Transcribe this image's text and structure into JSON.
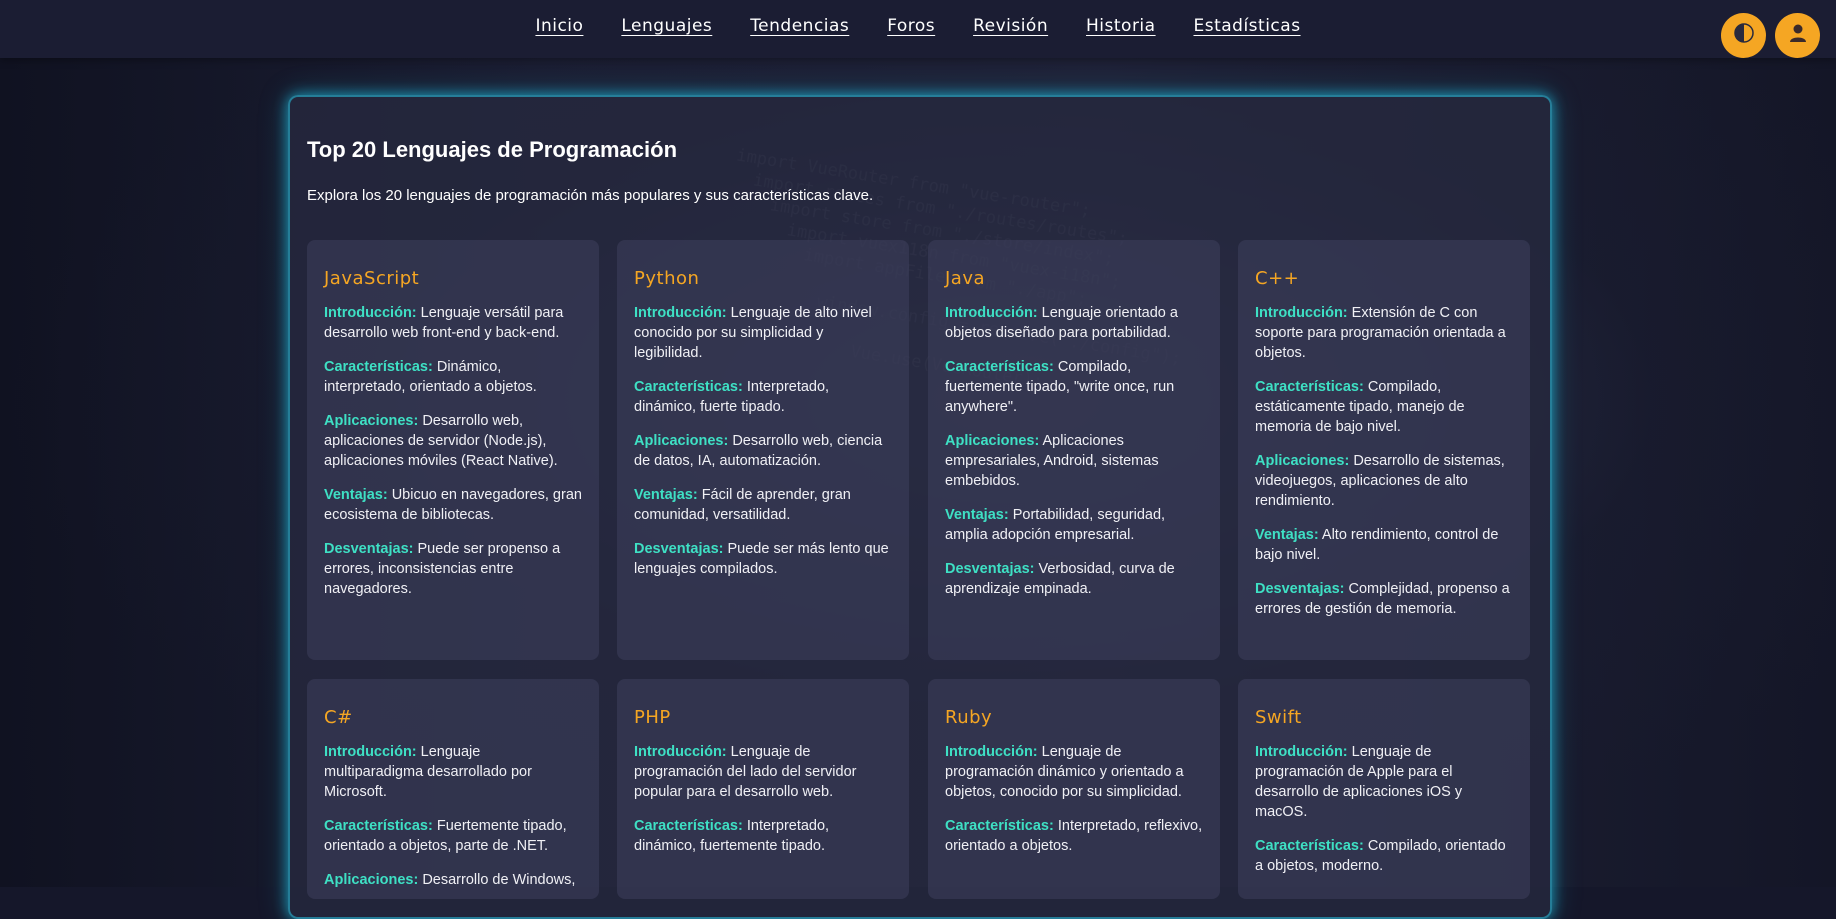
{
  "nav": {
    "links": [
      "Inicio",
      "Lenguajes",
      "Tendencias",
      "Foros",
      "Revisión",
      "Historia",
      "Estadísticas"
    ],
    "theme_toggle_icon": "theme-toggle-icon",
    "user_icon": "user-icon",
    "accent_color": "#f5a623"
  },
  "main": {
    "title": "Top 20 Lenguajes de Programación",
    "intro": "Explora los 20 lenguajes de programación más populares y sus características clave.",
    "keys": {
      "intro": "Introducción:",
      "features": "Características:",
      "apps": "Aplicaciones:",
      "pros": "Ventajas:",
      "cons": "Desventajas:"
    },
    "languages": [
      {
        "name": "JavaScript",
        "intro": "Lenguaje versátil para desarrollo web front-end y back-end.",
        "features": "Dinámico, interpretado, orientado a objetos.",
        "apps": "Desarrollo web, aplicaciones de servidor (Node.js), aplicaciones móviles (React Native).",
        "pros": "Ubicuo en navegadores, gran ecosistema de bibliotecas.",
        "cons": "Puede ser propenso a errores, inconsistencias entre navegadores."
      },
      {
        "name": "Python",
        "intro": "Lenguaje de alto nivel conocido por su simplicidad y legibilidad.",
        "features": "Interpretado, dinámico, fuerte tipado.",
        "apps": "Desarrollo web, ciencia de datos, IA, automatización.",
        "pros": "Fácil de aprender, gran comunidad, versatilidad.",
        "cons": "Puede ser más lento que lenguajes compilados."
      },
      {
        "name": "Java",
        "intro": "Lenguaje orientado a objetos diseñado para portabilidad.",
        "features": "Compilado, fuertemente tipado, \"write once, run anywhere\".",
        "apps": "Aplicaciones empresariales, Android, sistemas embebidos.",
        "pros": "Portabilidad, seguridad, amplia adopción empresarial.",
        "cons": "Verbosidad, curva de aprendizaje empinada."
      },
      {
        "name": "C++",
        "intro": "Extensión de C con soporte para programación orientada a objetos.",
        "features": "Compilado, estáticamente tipado, manejo de memoria de bajo nivel.",
        "apps": "Desarrollo de sistemas, videojuegos, aplicaciones de alto rendimiento.",
        "pros": "Alto rendimiento, control de bajo nivel.",
        "cons": "Complejidad, propenso a errores de gestión de memoria."
      },
      {
        "name": "C#",
        "intro": "Lenguaje multiparadigma desarrollado por Microsoft.",
        "features": "Fuertemente tipado, orientado a objetos, parte de .NET.",
        "apps": "Desarrollo de Windows,"
      },
      {
        "name": "PHP",
        "intro": "Lenguaje de programación del lado del servidor popular para el desarrollo web.",
        "features": "Interpretado, dinámico, fuertemente tipado."
      },
      {
        "name": "Ruby",
        "intro": "Lenguaje de programación dinámico y orientado a objetos, conocido por su simplicidad.",
        "features": "Interpretado, reflexivo, orientado a objetos."
      },
      {
        "name": "Swift",
        "intro": "Lenguaje de programación de Apple para el desarrollo de aplicaciones iOS y macOS.",
        "features": "Compilado, orientado a objetos, moderno."
      }
    ]
  }
}
